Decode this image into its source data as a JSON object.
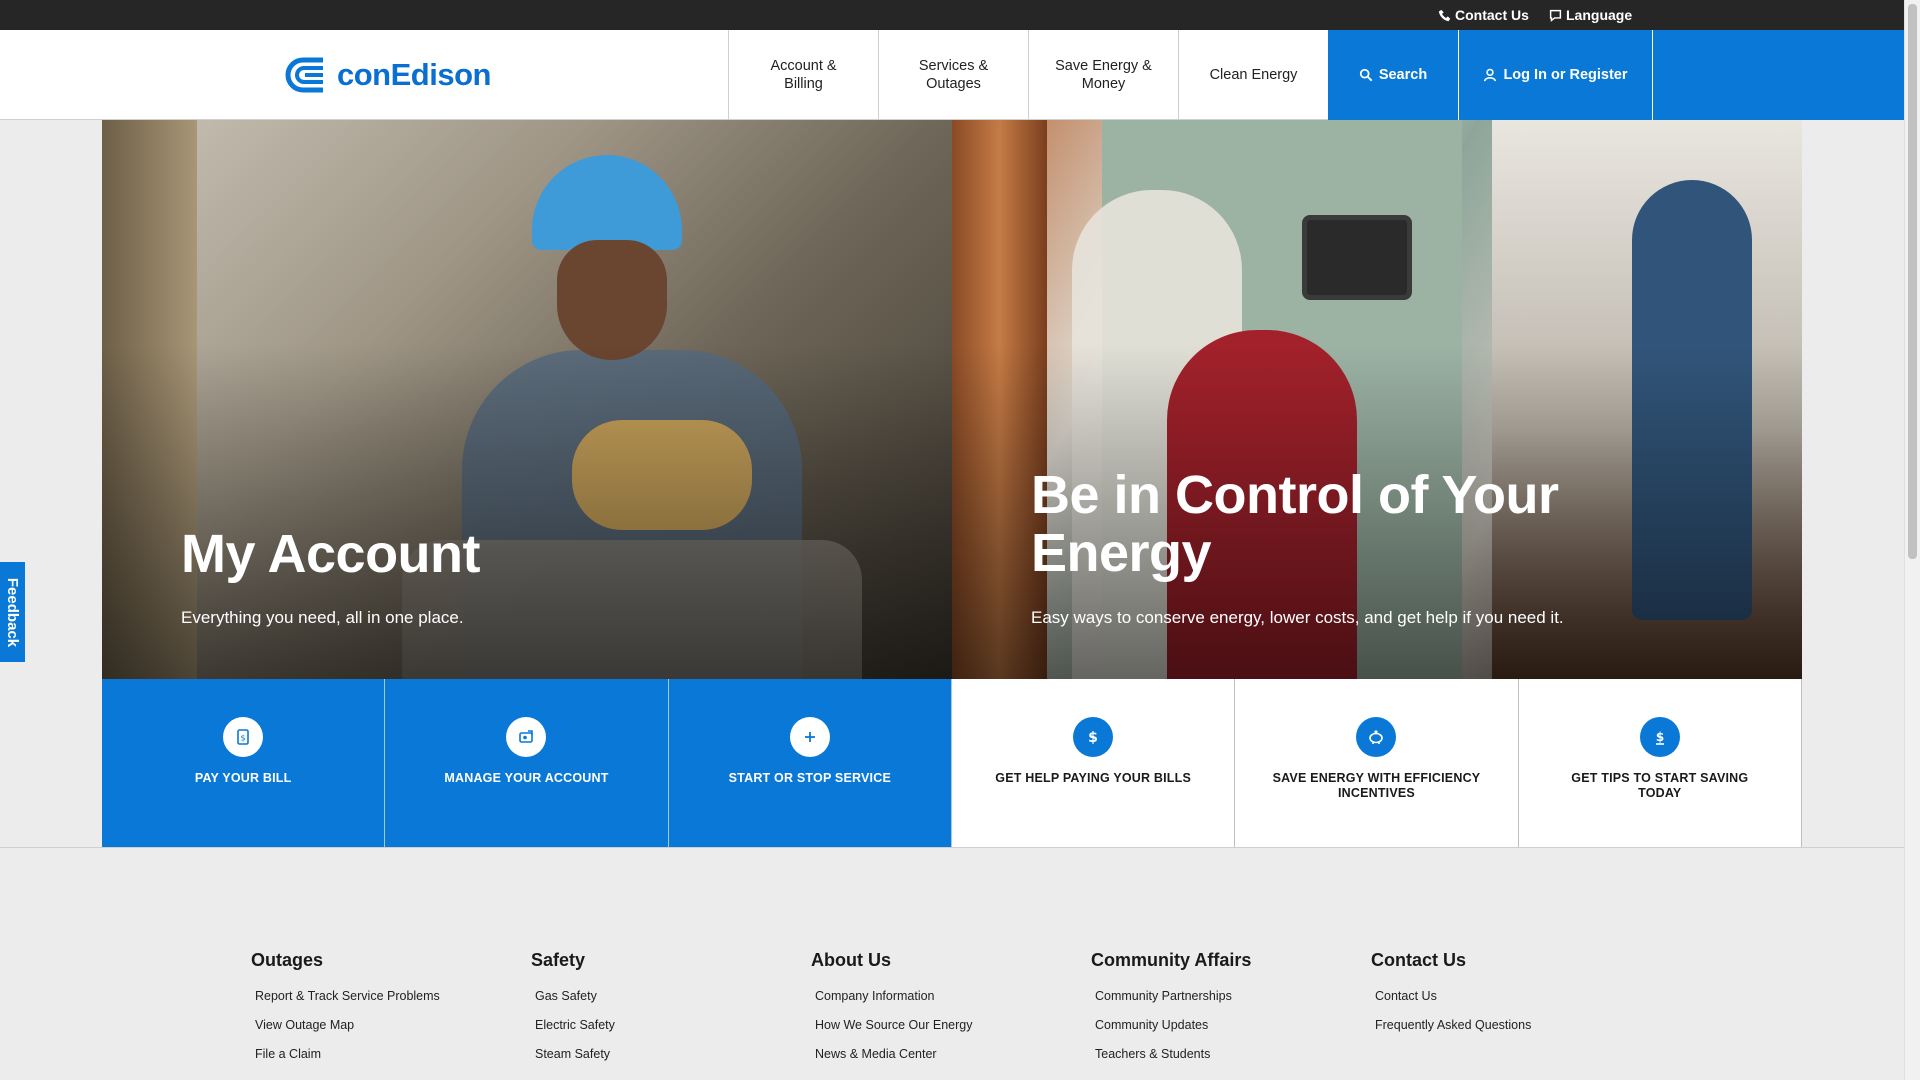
{
  "utility": {
    "contact_label": "Contact Us",
    "language_label": "Language"
  },
  "brand": {
    "logo_text": "conEdison",
    "accent": "#0a78d7"
  },
  "nav": {
    "items": [
      {
        "label": "Account & Billing"
      },
      {
        "label": "Services & Outages"
      },
      {
        "label": "Save Energy & Money"
      },
      {
        "label": "Clean Energy"
      }
    ],
    "search_label": "Search",
    "login_label": "Log In or Register"
  },
  "hero": {
    "left": {
      "title": "My Account",
      "subtitle": "Everything you need, all in one place."
    },
    "right": {
      "title": "Be in Control of Your Energy",
      "subtitle": "Easy ways to conserve energy, lower costs, and get help if you need it."
    }
  },
  "tiles": [
    {
      "label": "PAY YOUR BILL",
      "icon": "bill-icon"
    },
    {
      "label": "MANAGE YOUR ACCOUNT",
      "icon": "manage-account-icon"
    },
    {
      "label": "START OR STOP SERVICE",
      "icon": "plus-icon"
    },
    {
      "label": "GET HELP PAYING YOUR BILLS",
      "icon": "dollar-icon"
    },
    {
      "label": "SAVE ENERGY WITH EFFICIENCY INCENTIVES",
      "icon": "piggy-bank-icon"
    },
    {
      "label": "GET TIPS TO START SAVING TODAY",
      "icon": "dollar-tips-icon"
    }
  ],
  "footer": {
    "columns": [
      {
        "title": "Outages",
        "links": [
          "Report & Track Service Problems",
          "View Outage Map",
          "File a Claim"
        ]
      },
      {
        "title": "Safety",
        "links": [
          "Gas Safety",
          "Electric Safety",
          "Steam Safety"
        ]
      },
      {
        "title": "About Us",
        "links": [
          "Company Information",
          "How We Source Our Energy",
          "News & Media Center"
        ]
      },
      {
        "title": "Community Affairs",
        "links": [
          "Community Partnerships",
          "Community Updates",
          "Teachers & Students"
        ]
      },
      {
        "title": "Contact Us",
        "links": [
          "Contact Us",
          "Frequently Asked Questions"
        ]
      }
    ]
  },
  "feedback_label": "Feedback"
}
